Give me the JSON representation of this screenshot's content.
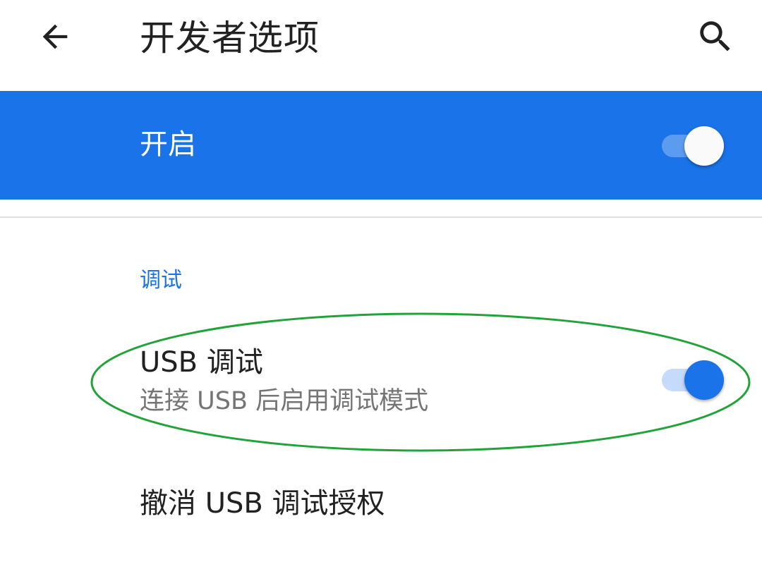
{
  "appbar": {
    "title": "开发者选项",
    "back_icon": "arrow-left-icon",
    "search_icon": "search-icon"
  },
  "master_switch": {
    "label": "开启",
    "checked": true
  },
  "category": {
    "title": "调试"
  },
  "preferences": [
    {
      "title": "USB 调试",
      "summary": "连接 USB 后启用调试模式",
      "checked": true
    },
    {
      "title": "撤消 USB 调试授权"
    }
  ],
  "annotation": {
    "shape": "ellipse",
    "color": "#22a33a",
    "target": "USB 调试"
  },
  "colors": {
    "accent": "#1a73e8",
    "master_bar": "#1a73e8",
    "switch_track_on": "#c6dafb",
    "divider": "#e0e0e0",
    "summary_text": "#757575"
  }
}
